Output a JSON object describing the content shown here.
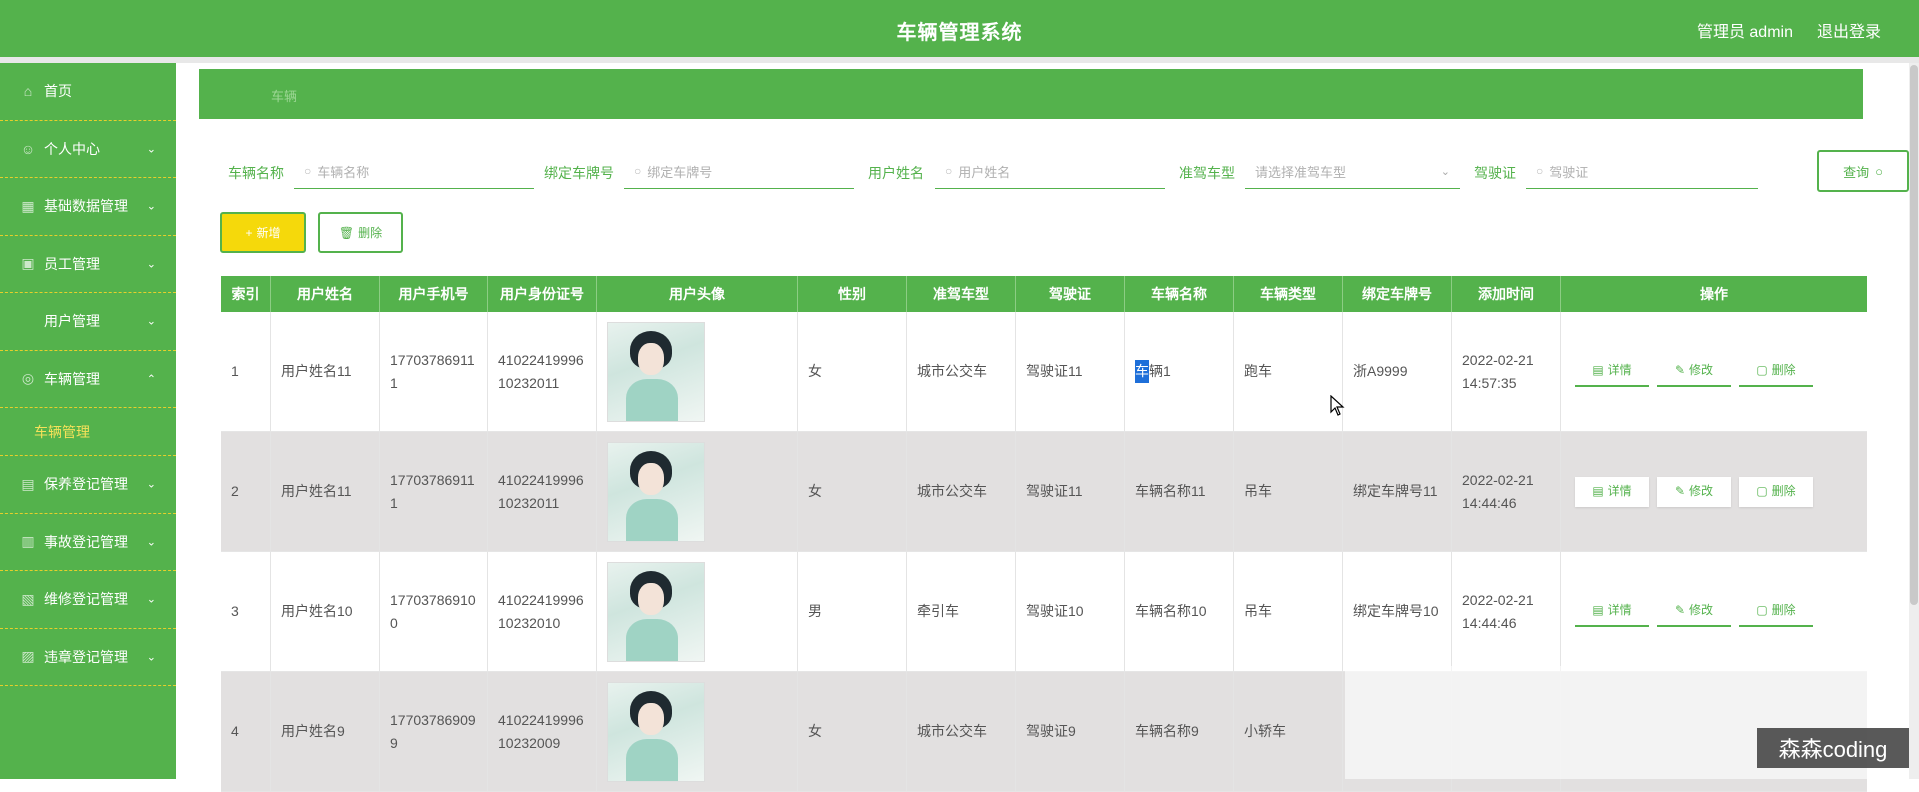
{
  "header": {
    "title": "车辆管理系统",
    "user": "管理员 admin",
    "logout": "退出登录"
  },
  "sidebar": {
    "items": [
      {
        "label": "首页",
        "icon": "home-icon",
        "chevron": ""
      },
      {
        "label": "个人中心",
        "icon": "person-icon",
        "chevron": "⌄"
      },
      {
        "label": "基础数据管理",
        "icon": "grid-icon",
        "chevron": "⌄"
      },
      {
        "label": "员工管理",
        "icon": "staff-icon",
        "chevron": "⌄"
      },
      {
        "label": "用户管理",
        "icon": "user-icon",
        "chevron": "⌄"
      },
      {
        "label": "车辆管理",
        "icon": "car-icon",
        "chevron": "⌃"
      },
      {
        "label": "保养登记管理",
        "icon": "wrench-icon",
        "chevron": "⌄"
      },
      {
        "label": "事故登记管理",
        "icon": "alert-icon",
        "chevron": "⌄"
      },
      {
        "label": "维修登记管理",
        "icon": "tool-icon",
        "chevron": "⌄"
      },
      {
        "label": "违章登记管理",
        "icon": "ticket-icon",
        "chevron": "⌄"
      }
    ],
    "active_sub": "车辆管理"
  },
  "breadcrumb": {
    "text": "车辆"
  },
  "filters": {
    "car_name_label": "车辆名称",
    "car_name_placeholder": "车辆名称",
    "plate_label": "绑定车牌号",
    "plate_placeholder": "绑定车牌号",
    "username_label": "用户姓名",
    "username_placeholder": "用户姓名",
    "license_type_label": "准驾车型",
    "license_type_placeholder": "请选择准驾车型",
    "license_label": "驾驶证",
    "license_placeholder": "驾驶证",
    "query_label": "查询"
  },
  "actions": {
    "add": "新增",
    "delete": "删除"
  },
  "table": {
    "columns": [
      "索引",
      "用户姓名",
      "用户手机号",
      "用户身份证号",
      "用户头像",
      "性别",
      "准驾车型",
      "驾驶证",
      "车辆名称",
      "车辆类型",
      "绑定车牌号",
      "添加时间",
      "操作"
    ],
    "op_labels": {
      "detail": "详情",
      "edit": "修改",
      "delete": "删除"
    },
    "rows": [
      {
        "idx": "1",
        "name": "用户姓名11",
        "phone1": "17703786911",
        "phone2": "1",
        "id1": "41022419996",
        "id2": "10232011",
        "gender": "女",
        "ltype": "城市公交车",
        "license": "驾驶证11",
        "car_hl": "车",
        "car_rest": "辆1",
        "ctype": "跑车",
        "plate": "浙A9999",
        "date": "2022-02-21",
        "time": "14:57:35"
      },
      {
        "idx": "2",
        "name": "用户姓名11",
        "phone1": "17703786911",
        "phone2": "1",
        "id1": "41022419996",
        "id2": "10232011",
        "gender": "女",
        "ltype": "城市公交车",
        "license": "驾驶证11",
        "car": "车辆名称11",
        "ctype": "吊车",
        "plate": "绑定车牌号11",
        "date": "2022-02-21",
        "time": "14:44:46"
      },
      {
        "idx": "3",
        "name": "用户姓名10",
        "phone1": "17703786910",
        "phone2": "0",
        "id1": "41022419996",
        "id2": "10232010",
        "gender": "男",
        "ltype": "牵引车",
        "license": "驾驶证10",
        "car": "车辆名称10",
        "ctype": "吊车",
        "plate": "绑定车牌号10",
        "date": "2022-02-21",
        "time": "14:44:46"
      },
      {
        "idx": "4",
        "name": "用户姓名9",
        "phone1": "17703786909",
        "phone2": "9",
        "id1": "41022419996",
        "id2": "10232009",
        "gender": "女",
        "ltype": "城市公交车",
        "license": "驾驶证9",
        "car": "车辆名称9",
        "ctype": "小轿车",
        "plate": "",
        "date": "",
        "time": ""
      }
    ]
  },
  "watermark": "森森coding"
}
